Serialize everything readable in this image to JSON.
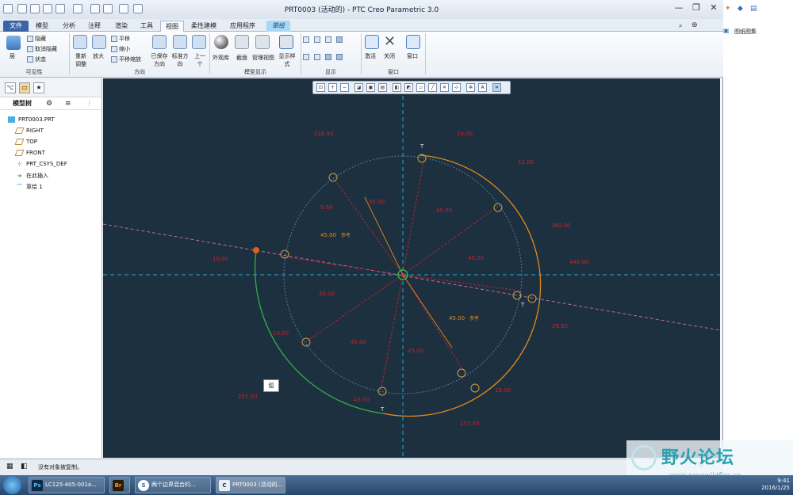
{
  "window": {
    "title": "PRT0003 (活动的) - PTC Creo Parametric 3.0",
    "accent": "#3b64a6"
  },
  "tabs": [
    "文件",
    "模型",
    "分析",
    "注释",
    "渲染",
    "工具",
    "视图",
    "柔性建模",
    "应用程序",
    "草绘"
  ],
  "active_tab": "视图",
  "ribbon": {
    "visibility": {
      "layer": "层",
      "hide": "隐藏",
      "unhide": "取消隐藏",
      "status": "状态",
      "group": "可见性"
    },
    "orientation": {
      "refit": "重新调整",
      "zoom_in": "放大",
      "pan": "平移",
      "zoom_out": "缩小",
      "pan_zoom": "平移缩放",
      "saved": "已保存方向",
      "standard": "标准方向",
      "previous": "上一个",
      "group": "方向"
    },
    "model_display": {
      "appearance": "外观库",
      "section": "截面",
      "manage_views": "管理视图",
      "display_style": "显示样式",
      "group": "模型显示"
    },
    "show": {
      "group": "显示"
    },
    "window": {
      "activate": "激活",
      "close": "关闭",
      "windows": "窗口",
      "group": "窗口"
    }
  },
  "model_tree": {
    "header": "模型树",
    "items": [
      {
        "label": "PRT0003.PRT",
        "icon": "part-icon"
      },
      {
        "label": "RIGHT",
        "icon": "datum-plane-icon"
      },
      {
        "label": "TOP",
        "icon": "datum-plane-icon"
      },
      {
        "label": "FRONT",
        "icon": "datum-plane-icon"
      },
      {
        "label": "PRT_CSYS_DEF",
        "icon": "csys-icon"
      },
      {
        "label": "在此插入",
        "icon": "insert-here-icon"
      },
      {
        "label": "草绘 1",
        "icon": "sketch-icon"
      }
    ]
  },
  "sketch": {
    "dimensions": [
      "228.93",
      "14.00",
      "12.00",
      "9.50",
      "45.00",
      "45.00",
      "280.00",
      "45.00",
      "参考",
      "10.00",
      "446.00",
      "45.00",
      "45.00",
      "45.00",
      "45.00",
      "参考",
      "26.50",
      "10.00",
      "45.00",
      "45.00",
      "19.00",
      "257.50",
      "257.50"
    ],
    "tooltip": "弧",
    "colors": {
      "background": "#1d3040",
      "dimension": "#c8202a",
      "geometry": "#e08a18",
      "selected": "#30b040",
      "centerline": "#20a8c8",
      "construction": "#c86aa0"
    }
  },
  "status": {
    "message": "没有对象被复制。"
  },
  "right_strip": {
    "label": "图纸图集"
  },
  "taskbar": {
    "items": [
      {
        "icon": "Ps",
        "label": "LC125-405-001a..."
      },
      {
        "icon": "Br",
        "label": ""
      },
      {
        "icon": "S",
        "label": "两个边界混合的..."
      },
      {
        "icon": "C",
        "label": "PRT0003 (活动的..."
      }
    ],
    "time": "9:41",
    "date": "2016/1/25"
  },
  "watermark": {
    "title": "野火论坛",
    "sub": "www.proewildfire.cn"
  }
}
